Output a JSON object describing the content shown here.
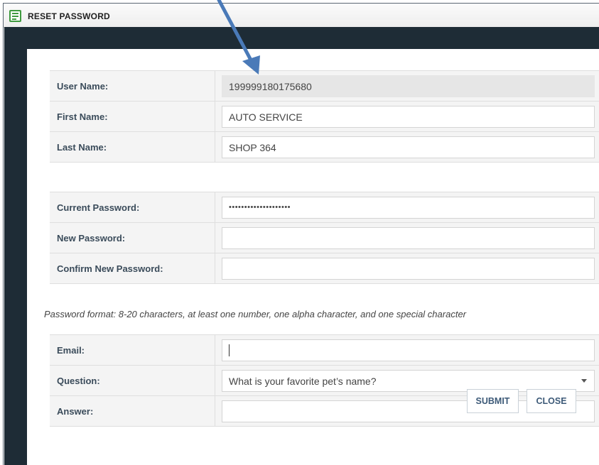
{
  "window": {
    "title": "RESET PASSWORD",
    "icon": "form-icon"
  },
  "account": {
    "user_name_label": "User Name:",
    "user_name_value": "199999180175680",
    "first_name_label": "First Name:",
    "first_name_value": "AUTO SERVICE",
    "last_name_label": "Last Name:",
    "last_name_value": "SHOP 364"
  },
  "password": {
    "current_label": "Current Password:",
    "current_value": "••••••••••••••••••••",
    "new_label": "New Password:",
    "new_value": "",
    "confirm_label": "Confirm New Password:",
    "confirm_value": "",
    "format_hint": "Password format: 8-20 characters, at least one number, one alpha character, and one special character"
  },
  "security": {
    "email_label": "Email:",
    "email_value": "",
    "question_label": "Question:",
    "question_value": "What is your favorite pet’s name?",
    "answer_label": "Answer:",
    "answer_value": ""
  },
  "buttons": {
    "submit": "SUBMIT",
    "close": "CLOSE"
  },
  "colors": {
    "backdrop": "#1e2c36",
    "label_text": "#3a4b5a",
    "button_text": "#3d5a78",
    "arrow": "#4a7ab8"
  }
}
